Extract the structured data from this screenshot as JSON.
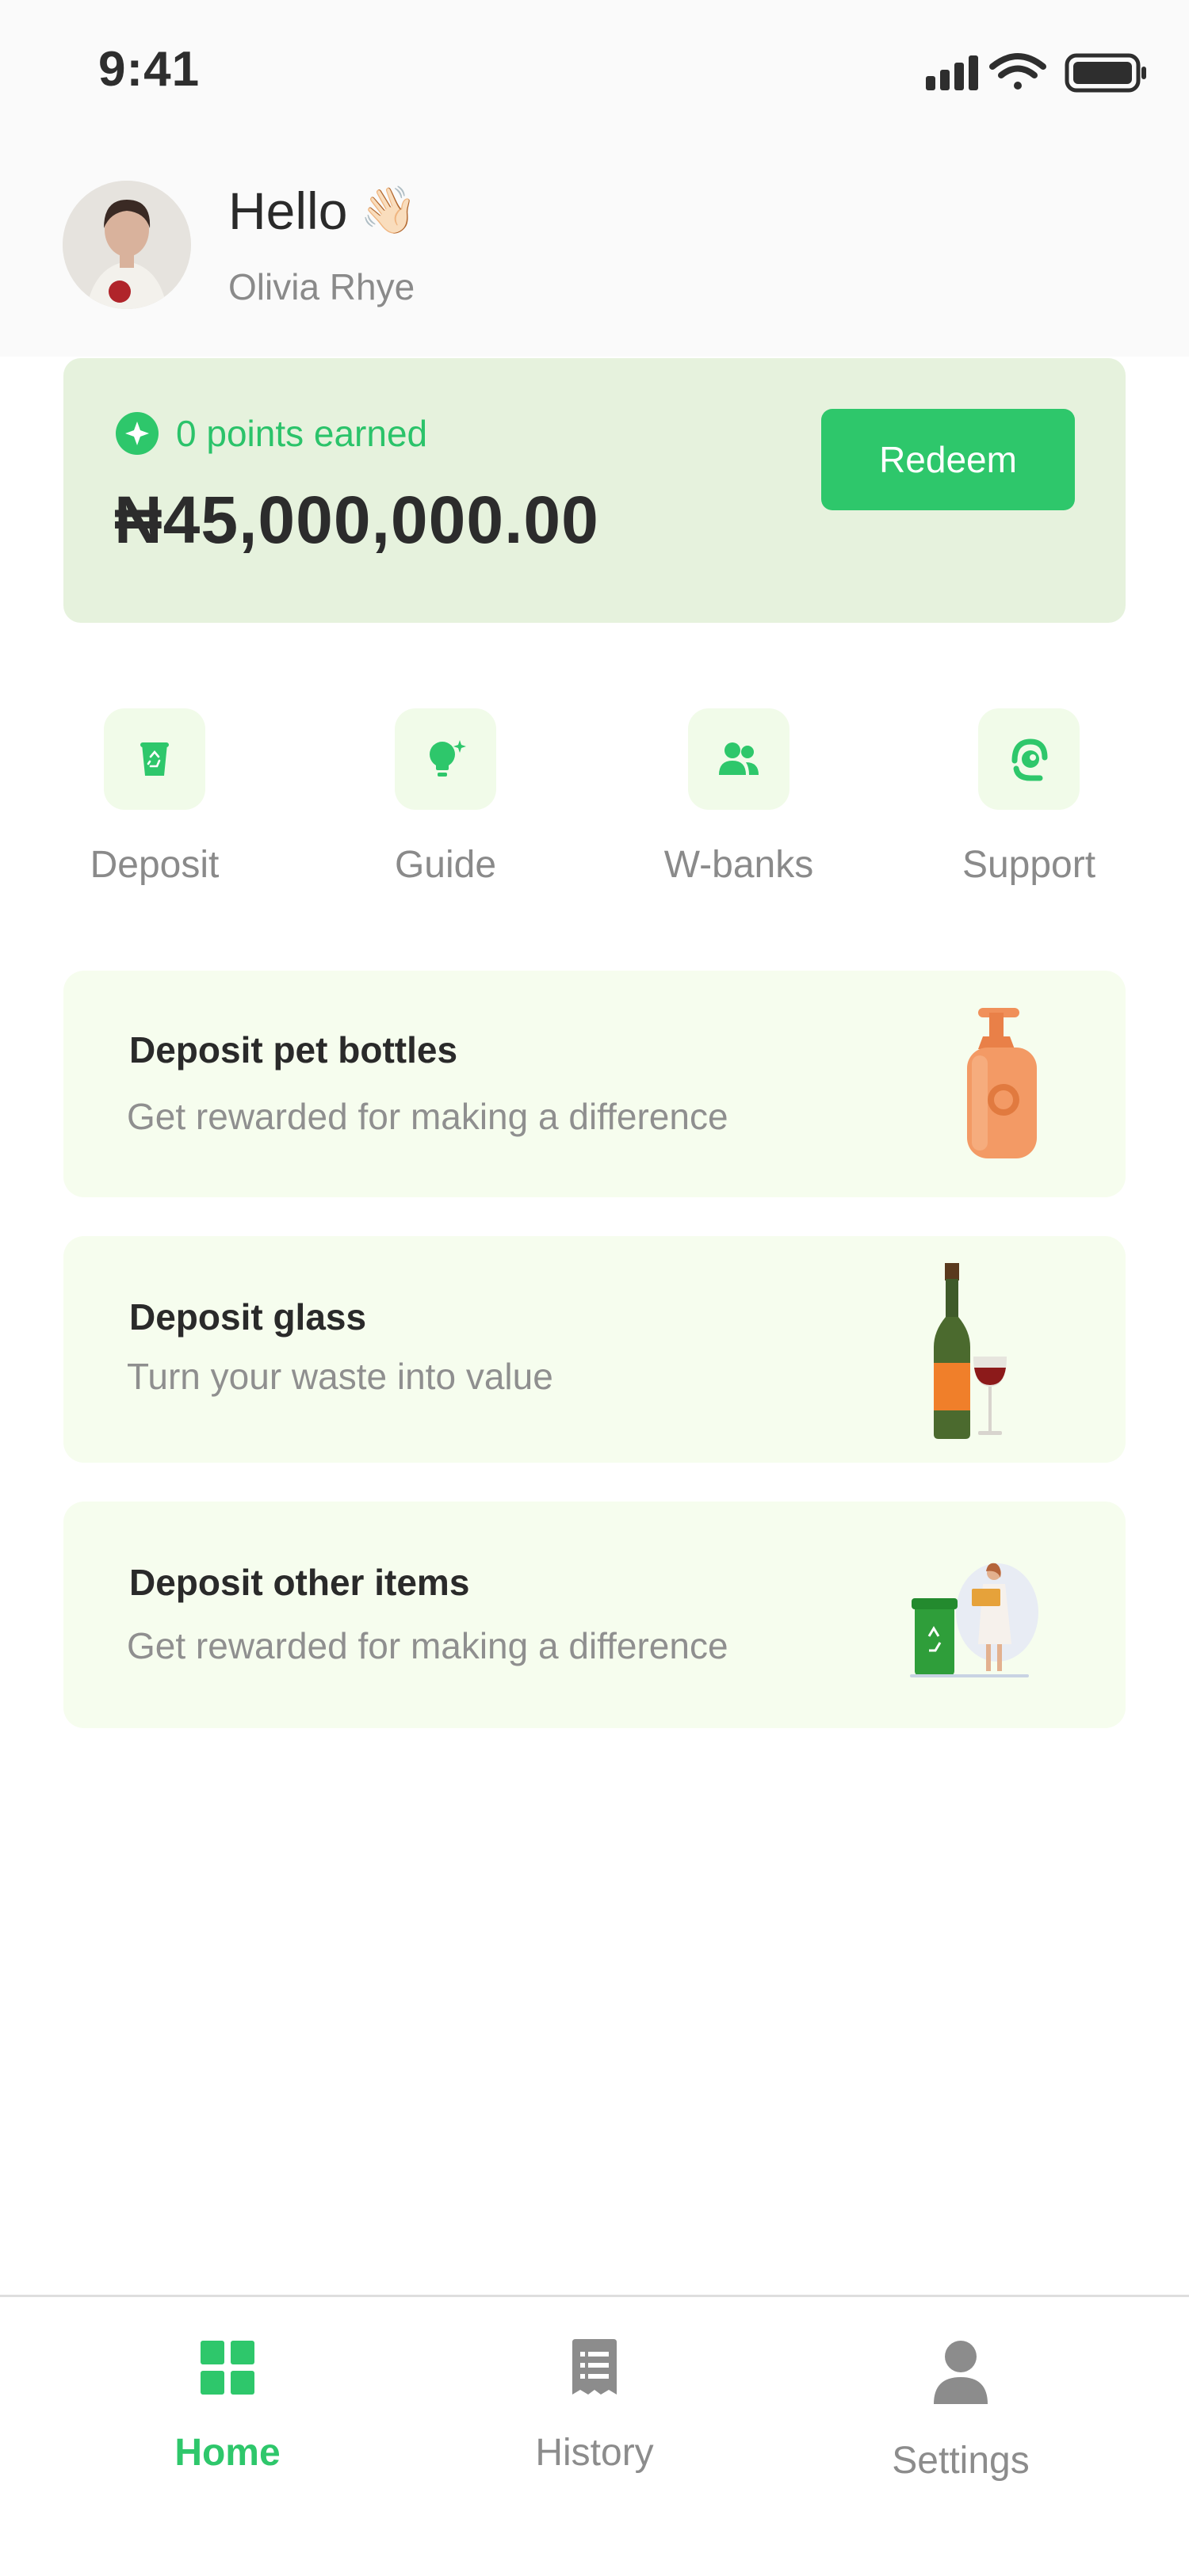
{
  "status_bar": {
    "time": "9:41"
  },
  "header": {
    "greeting": "Hello",
    "greeting_emoji": "👋🏻",
    "user_name": "Olivia Rhye"
  },
  "points_card": {
    "points_label": "0 points earned",
    "balance": "₦45,000,000.00",
    "redeem_label": "Redeem"
  },
  "quick_actions": [
    {
      "label": "Deposit",
      "icon": "recycle-bin-icon"
    },
    {
      "label": "Guide",
      "icon": "lightbulb-icon"
    },
    {
      "label": "W-banks",
      "icon": "users-icon"
    },
    {
      "label": "Support",
      "icon": "headset-icon"
    }
  ],
  "deposit_cards": [
    {
      "title": "Deposit pet bottles",
      "subtitle": "Get rewarded for making a difference",
      "illustration": "pump-bottle-illustration"
    },
    {
      "title": "Deposit glass",
      "subtitle": "Turn your waste into value",
      "illustration": "wine-bottle-glass-illustration"
    },
    {
      "title": "Deposit other items",
      "subtitle": "Get rewarded for making a difference",
      "illustration": "person-recycling-illustration"
    }
  ],
  "bottom_nav": [
    {
      "label": "Home",
      "icon": "grid-icon",
      "active": true
    },
    {
      "label": "History",
      "icon": "receipt-icon",
      "active": false
    },
    {
      "label": "Settings",
      "icon": "user-icon",
      "active": false
    }
  ],
  "colors": {
    "accent": "#2ec76b",
    "card_green": "#e6f2dd",
    "card_light": "#f6fdee",
    "muted": "#8a8a8a"
  }
}
